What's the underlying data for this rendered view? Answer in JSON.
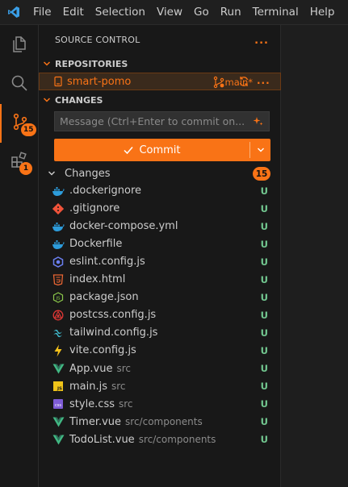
{
  "menubar": {
    "logo_icon": "vscode-logo-icon",
    "items": [
      "File",
      "Edit",
      "Selection",
      "View",
      "Go",
      "Run",
      "Terminal",
      "Help"
    ]
  },
  "activitybar": {
    "items": [
      {
        "icon": "files-icon",
        "badge": ""
      },
      {
        "icon": "search-icon",
        "badge": ""
      },
      {
        "icon": "source-control-icon",
        "badge": "15",
        "active": true
      },
      {
        "icon": "extensions-icon",
        "badge": "1"
      }
    ]
  },
  "sidebar": {
    "title": "SOURCE CONTROL",
    "more": "...",
    "repositories": {
      "header": "REPOSITORIES",
      "repo": {
        "name": "smart-pomo",
        "branch": "main*"
      }
    },
    "changes": {
      "header": "CHANGES",
      "commit_placeholder": "Message (Ctrl+Enter to commit on...",
      "commit_label": "Commit",
      "group_label": "Changes",
      "count": "15",
      "files": [
        {
          "name": ".dockerignore",
          "dir": "",
          "status": "U",
          "icon": "docker-icon"
        },
        {
          "name": ".gitignore",
          "dir": "",
          "status": "U",
          "icon": "git-icon"
        },
        {
          "name": "docker-compose.yml",
          "dir": "",
          "status": "U",
          "icon": "docker-icon"
        },
        {
          "name": "Dockerfile",
          "dir": "",
          "status": "U",
          "icon": "docker-icon"
        },
        {
          "name": "eslint.config.js",
          "dir": "",
          "status": "U",
          "icon": "eslint-icon"
        },
        {
          "name": "index.html",
          "dir": "",
          "status": "U",
          "icon": "html-icon"
        },
        {
          "name": "package.json",
          "dir": "",
          "status": "U",
          "icon": "nodejs-icon"
        },
        {
          "name": "postcss.config.js",
          "dir": "",
          "status": "U",
          "icon": "postcss-icon"
        },
        {
          "name": "tailwind.config.js",
          "dir": "",
          "status": "U",
          "icon": "tailwind-icon"
        },
        {
          "name": "vite.config.js",
          "dir": "",
          "status": "U",
          "icon": "vite-icon"
        },
        {
          "name": "App.vue",
          "dir": "src",
          "status": "U",
          "icon": "vue-icon"
        },
        {
          "name": "main.js",
          "dir": "src",
          "status": "U",
          "icon": "javascript-icon"
        },
        {
          "name": "style.css",
          "dir": "src",
          "status": "U",
          "icon": "css-icon"
        },
        {
          "name": "Timer.vue",
          "dir": "src/components",
          "status": "U",
          "icon": "vue-icon"
        },
        {
          "name": "TodoList.vue",
          "dir": "src/components",
          "status": "U",
          "icon": "vue-icon"
        }
      ]
    }
  },
  "colors": {
    "accent": "#f97316",
    "untracked": "#73c991",
    "background": "#181818"
  }
}
